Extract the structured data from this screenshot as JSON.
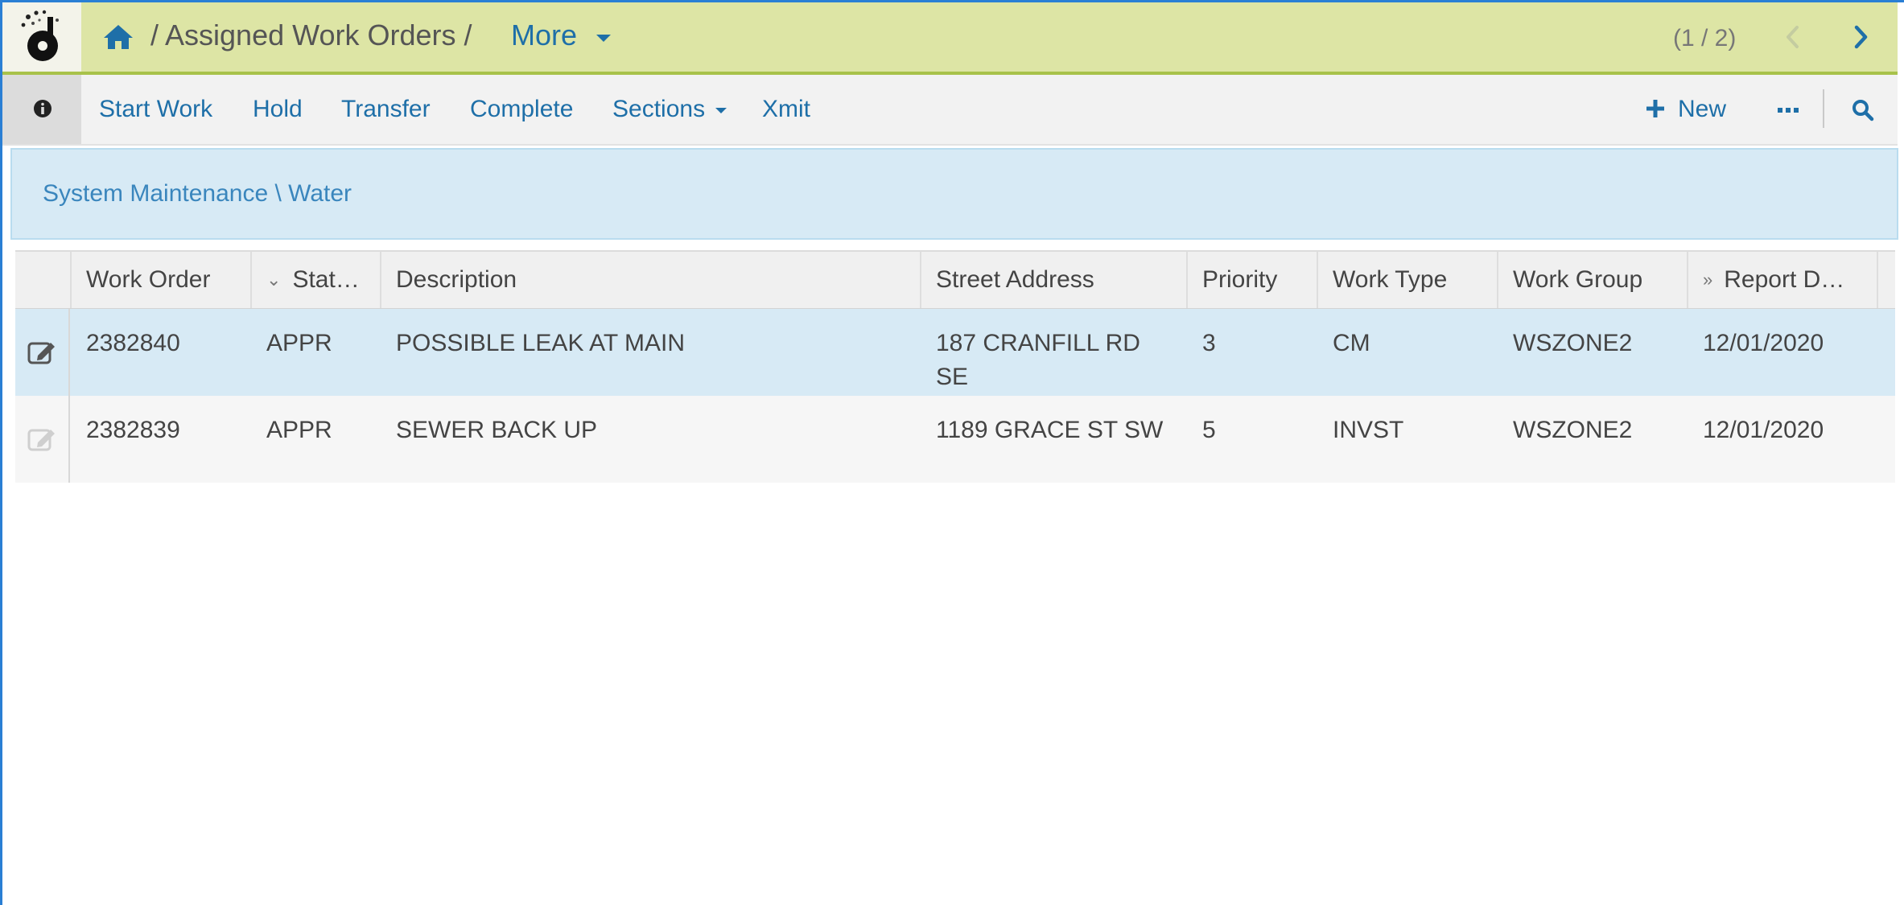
{
  "header": {
    "breadcrumb_title": "/ Assigned Work Orders /",
    "more_label": "More",
    "pager": "(1 / 2)"
  },
  "toolbar": {
    "buttons": [
      "Start Work",
      "Hold",
      "Transfer",
      "Complete",
      "Sections",
      "Xmit"
    ],
    "new_label": "New"
  },
  "path": {
    "text": "System Maintenance \\ Water"
  },
  "grid": {
    "columns": [
      "Work Order",
      "Stat…",
      "Description",
      "Street Address",
      "Priority",
      "Work Type",
      "Work Group",
      "Report D…"
    ],
    "rows": [
      {
        "work_order": "2382840",
        "status": "APPR",
        "description": "POSSIBLE LEAK AT MAIN",
        "address": "187 CRANFILL RD SE",
        "priority": "3",
        "work_type": "CM",
        "work_group": "WSZONE2",
        "report_date": "12/01/2020"
      },
      {
        "work_order": "2382839",
        "status": "APPR",
        "description": "SEWER BACK UP",
        "address": "1189 GRACE ST SW",
        "priority": "5",
        "work_type": "INVST",
        "work_group": "WSZONE2",
        "report_date": "12/01/2020"
      }
    ]
  },
  "colors": {
    "titlebar_bg": "#dde5a5",
    "link_blue": "#1e6fa8",
    "selected_row": "#d7eaf5"
  }
}
